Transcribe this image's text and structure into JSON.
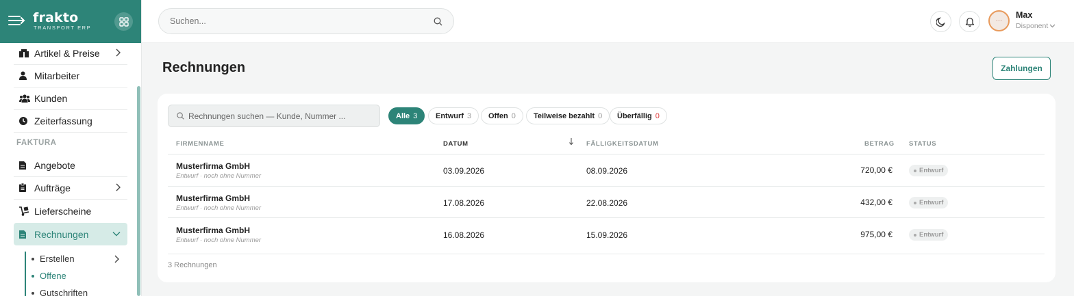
{
  "brand": {
    "name": "frakto",
    "subtitle": "TRANSPORT ERP"
  },
  "sidebar": {
    "items": [
      {
        "label": "Artikel & Preise",
        "icon": "boxes-icon",
        "has_chevron": true
      },
      {
        "label": "Mitarbeiter",
        "icon": "person-icon"
      },
      {
        "label": "Kunden",
        "icon": "users-icon"
      },
      {
        "label": "Zeiterfassung",
        "icon": "clock-icon"
      }
    ],
    "section": "FAKTURA",
    "faktura_items": [
      {
        "label": "Angebote",
        "icon": "document-icon"
      },
      {
        "label": "Aufträge",
        "icon": "clipboard-icon",
        "has_chevron": true
      },
      {
        "label": "Lieferscheine",
        "icon": "dolly-icon"
      },
      {
        "label": "Rechnungen",
        "icon": "invoice-icon",
        "active": true
      }
    ],
    "subitems": [
      {
        "label": "Erstellen",
        "has_chevron": true
      },
      {
        "label": "Offene",
        "active": true
      },
      {
        "label": "Gutschriften"
      }
    ]
  },
  "header": {
    "search_placeholder": "Suchen...",
    "user": {
      "name": "Max",
      "role": "Disponent"
    }
  },
  "main": {
    "title": "Rechnungen",
    "payments_button": "Zahlungen",
    "table_search_placeholder": "Rechnungen suchen — Kunde, Nummer ...",
    "filters": [
      {
        "label": "Alle",
        "count": "3",
        "active": true
      },
      {
        "label": "Entwurf",
        "count": "3"
      },
      {
        "label": "Offen",
        "count": "0"
      },
      {
        "label": "Teilweise bezahlt",
        "count": "0"
      },
      {
        "label": "Überfällig",
        "count": "0",
        "alert": true
      }
    ],
    "columns": {
      "firm": "FIRMENNAME",
      "date": "DATUM",
      "due": "FÄLLIGKEITSDATUM",
      "amount": "BETRAG",
      "status": "STATUS"
    },
    "rows": [
      {
        "firm": "Musterfirma GmbH",
        "note": "Entwurf · noch ohne Nummer",
        "date": "03.09.2026",
        "due": "08.09.2026",
        "amount": "720,00 €",
        "status": "Entwurf"
      },
      {
        "firm": "Musterfirma GmbH",
        "note": "Entwurf · noch ohne Nummer",
        "date": "17.08.2026",
        "due": "22.08.2026",
        "amount": "432,00 €",
        "status": "Entwurf"
      },
      {
        "firm": "Musterfirma GmbH",
        "note": "Entwurf · noch ohne Nummer",
        "date": "16.08.2026",
        "due": "15.09.2026",
        "amount": "975,00 €",
        "status": "Entwurf"
      }
    ],
    "footer": "3 Rechnungen"
  },
  "colors": {
    "accent": "#2d8478",
    "accent_light": "#d6ebe7",
    "alert": "#dd3333"
  }
}
